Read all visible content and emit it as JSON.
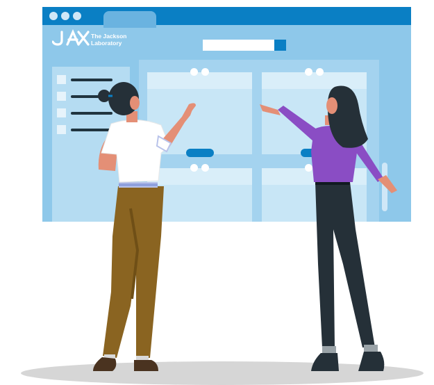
{
  "brand": {
    "logo_mark": "JAX",
    "name_line1": "The Jackson",
    "name_line2": "Laboratory"
  },
  "colors": {
    "accent": "#0a7fc4",
    "window_bg": "#8ec8ea",
    "shirt_left": "#ffffff",
    "pants_left": "#8a6421",
    "shirt_right": "#8a4dc4",
    "pants_right": "#253038"
  },
  "icons": [
    "window-control-dots",
    "search-button-icon",
    "checkbox-icon"
  ]
}
